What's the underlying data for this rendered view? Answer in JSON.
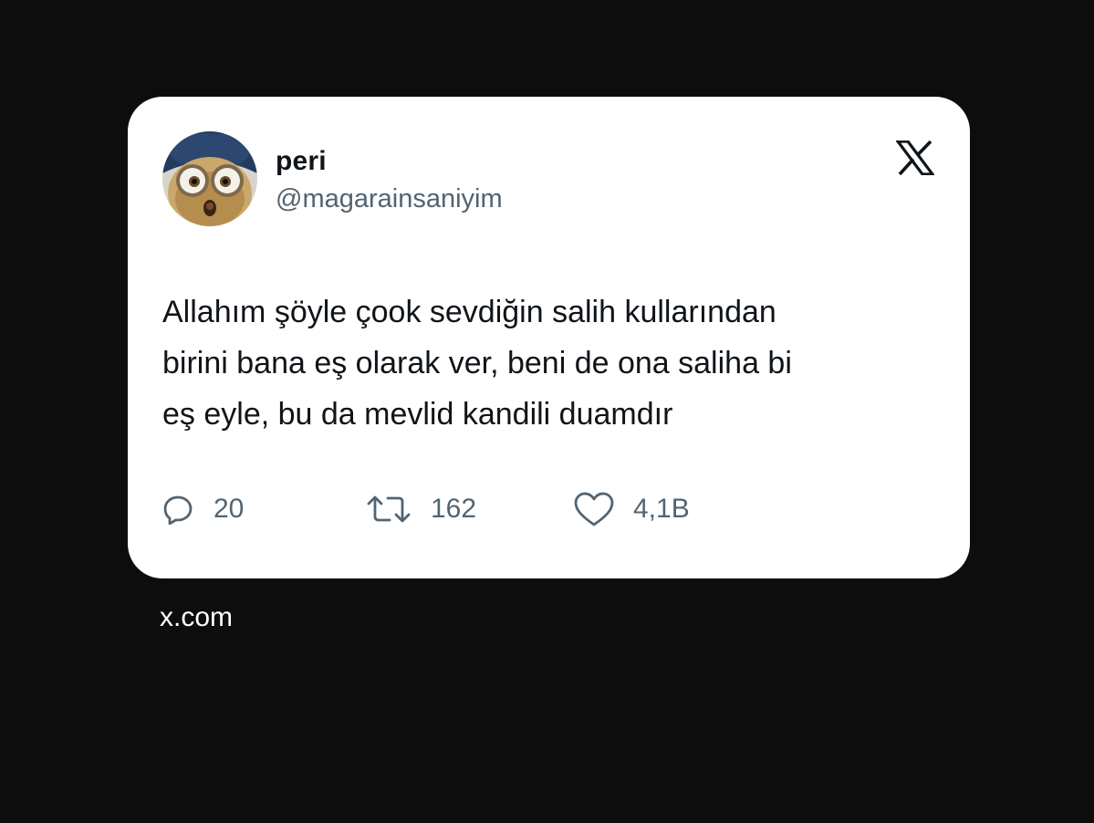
{
  "user": {
    "display_name": "peri",
    "handle": "@magarainsaniyim",
    "avatar_icon": "owl-character-avatar"
  },
  "brand_icon": "x-logo-icon",
  "tweet": {
    "lines": [
      "Allahım şöyle çook sevdiğin salih kullarından",
      "birini bana eş olarak ver, beni de ona saliha bi",
      "eş eyle, bu da mevlid kandili duamdır"
    ]
  },
  "metrics": {
    "replies": "20",
    "reposts": "162",
    "likes": "4,1B"
  },
  "footer": {
    "site": "x.com"
  },
  "colors": {
    "background": "#0d0d0d",
    "card": "#ffffff",
    "text_primary": "#0f1419",
    "text_secondary": "#536471"
  }
}
